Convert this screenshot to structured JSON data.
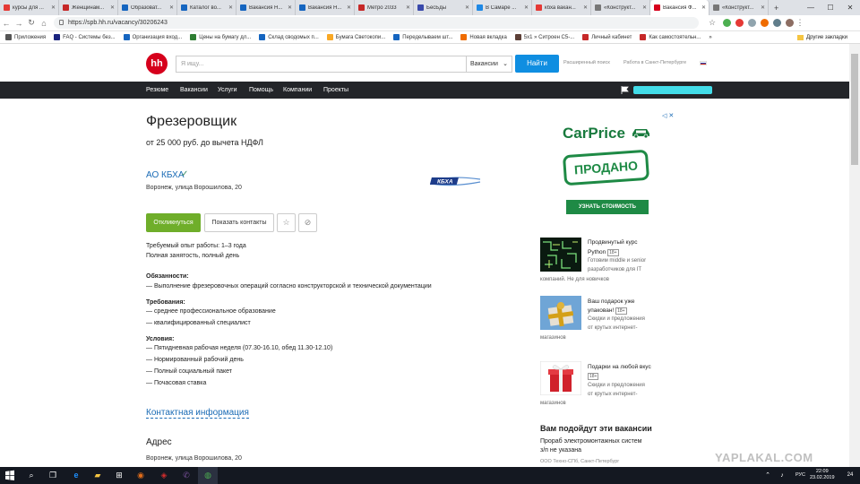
{
  "browser": {
    "tabs": [
      {
        "title": "курсы для ...",
        "color": "#e53935"
      },
      {
        "title": "Женщинам...",
        "color": "#c62828"
      },
      {
        "title": "Образоват...",
        "color": "#1565c0"
      },
      {
        "title": "Каталог во...",
        "color": "#1565c0"
      },
      {
        "title": "Вакансия Н...",
        "color": "#1565c0"
      },
      {
        "title": "Вакансия Н...",
        "color": "#1565c0"
      },
      {
        "title": "Метро 2033",
        "color": "#c62828"
      },
      {
        "title": "БесБды",
        "color": "#3949ab"
      },
      {
        "title": "В Самаре ...",
        "color": "#1e88e5"
      },
      {
        "title": "кбха вакан...",
        "color": "#e53935"
      },
      {
        "title": "«Конструкт...",
        "color": "#777777"
      },
      {
        "title": "Вакансия Ф...",
        "color": "#d6001c"
      },
      {
        "title": "«Конструкт...",
        "color": "#777777"
      }
    ],
    "active_tab_index": 11,
    "new_tab": "+",
    "window_controls": {
      "min": "—",
      "max": "☐",
      "close": "✕"
    },
    "url": "https://spb.hh.ru/vacancy/30206243",
    "star": "☆",
    "menu": "⋮",
    "nav": {
      "back": "←",
      "forward": "→",
      "reload": "↻",
      "home": "⌂"
    },
    "bookmarks": [
      {
        "label": "Приложения",
        "color": "#555555"
      },
      {
        "label": "FAQ - Системы без...",
        "color": "#1a237e"
      },
      {
        "label": "Организация вход...",
        "color": "#1565c0"
      },
      {
        "label": "Цены на бумагу дл...",
        "color": "#2e7d32"
      },
      {
        "label": "Склад сводомых п...",
        "color": "#1565c0"
      },
      {
        "label": "Бумага Светокопи...",
        "color": "#f9a825"
      },
      {
        "label": "Переделываем шт...",
        "color": "#1565c0"
      },
      {
        "label": "Новая вкладка",
        "color": "#ef6c00"
      },
      {
        "label": "5х1 » Ситроен С5-...",
        "color": "#5d4037"
      },
      {
        "label": "Личный кабинет",
        "color": "#c62828"
      },
      {
        "label": "Как самостоятельн...",
        "color": "#c62828"
      }
    ],
    "bookmarks_more": "»",
    "bookmarks_other": "Другие закладки"
  },
  "header": {
    "logo": "hh",
    "search_placeholder": "Я ищу...",
    "search_scope": "Вакансии",
    "search_button": "Найти",
    "advanced_search": "Расширенный поиск",
    "work_city": "Работа в Санкт-Петербурге"
  },
  "nav": {
    "items": [
      "Резюме",
      "Вакансии",
      "Услуги",
      "Помощь",
      "Компании",
      "Проекты"
    ]
  },
  "vacancy": {
    "title": "Фрезеровщик",
    "salary": "от 25 000 руб. до вычета НДФЛ",
    "company": "АО КБХА",
    "company_logo_text": "КБХА",
    "address": "Воронеж, улица Ворошилова, 20",
    "respond_button": "Откликнуться",
    "show_contacts_button": "Показать контакты",
    "experience": "Требуемый опыт работы: 1–3 года",
    "employment": "Полная занятость, полный день",
    "duties_head": "Обязанности:",
    "duties": [
      "— Выполнение фрезеровочных операций согласно конструкторской и технической документации"
    ],
    "requirements_head": "Требования:",
    "requirements": [
      "— среднее профессиональное образование",
      "— квалифицированный специалист"
    ],
    "conditions_head": "Условия:",
    "conditions": [
      "— Пятидневная рабочая неделя (07.30-16.10, обед 11.30-12.10)",
      "— Нормированный рабочий день",
      "— Полный социальный пакет",
      "— Почасовая ставка"
    ],
    "contact_head": "Контактная информация",
    "address_head": "Адрес",
    "address_body": "Воронеж, улица Ворошилова, 20"
  },
  "ad": {
    "brand": "CarPrice",
    "stamp": "ПРОДАНО",
    "button": "УЗНАТЬ СТОИМОСТЬ",
    "badge": "◁ ✕",
    "brand_color": "#1e8a45"
  },
  "promos": [
    {
      "title": "Продвинутый курс",
      "title2": "Python",
      "age": "18+",
      "lines": [
        "Готовим middle и senior",
        "разработчиков для IT",
        "компаний. Не для новичков"
      ]
    },
    {
      "title": "Ваш подарок уже",
      "title2": "упакован!",
      "age": "18+",
      "lines": [
        "Скидки и предложения",
        "от крутых интернет-",
        "магазинов"
      ]
    },
    {
      "title": "Подарки на любой вкус",
      "title2": "",
      "age": "18+",
      "lines": [
        "Скидки и предложения",
        "от крутых интернет-",
        "магазинов"
      ]
    }
  ],
  "suitable": {
    "head": "Вам подойдут эти вакансии",
    "job_line1": "Прораб электромонтажных систем",
    "job_line2": "з/п не указана",
    "company": "ООО Техно-СПб, Санкт-Петербург"
  },
  "watermark": "YAPLAKAL.COM",
  "taskbar": {
    "lang": "РУС",
    "time": "22:09",
    "date": "23.02.2019",
    "notif": "24"
  }
}
